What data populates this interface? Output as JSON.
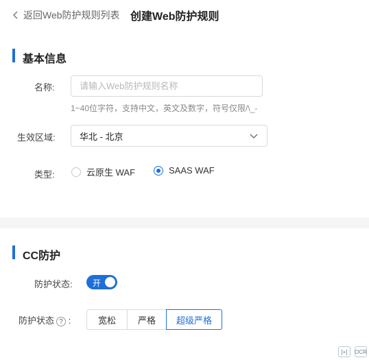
{
  "header": {
    "back_label": "返回Web防护规则列表",
    "title": "创建Web防护规则"
  },
  "basic": {
    "section_title": "基本信息",
    "name_label": "名称:",
    "name_placeholder": "请输入Web防护规则名称",
    "name_value": "",
    "name_hint": "1~40位字符，支持中文，英文及数字，符号仅限/\\_-",
    "region_label": "生效区域:",
    "region_value": "华北 - 北京",
    "type_label": "类型:",
    "type_options": [
      "云原生 WAF",
      "SAAS WAF"
    ],
    "type_selected": "SAAS WAF"
  },
  "cc": {
    "section_title": "CC防护",
    "status_label": "防护状态:",
    "toggle_text": "开",
    "toggle_on": true,
    "level_label": "防护状态",
    "level_options": [
      "宽松",
      "严格",
      "超级严格"
    ],
    "level_selected": "超级严格"
  },
  "corner": {
    "btn1": "[+]",
    "btn2": "OCR"
  },
  "colors": {
    "accent": "#1e6fd9",
    "divider": "#f4f5f7"
  }
}
